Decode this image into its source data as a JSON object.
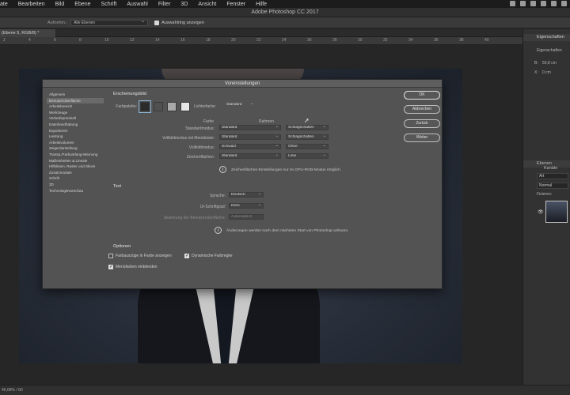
{
  "menubar": {
    "items": [
      "ate",
      "Bearbeiten",
      "Bild",
      "Ebene",
      "Schrift",
      "Auswahl",
      "Filter",
      "3D",
      "Ansicht",
      "Fenster",
      "Hilfe"
    ]
  },
  "app": {
    "title": "Adobe Photoshop CC 2017"
  },
  "options_bar": {
    "sample_label": "Aufnehm.:",
    "sample_value": "Alle Ebenen",
    "show_ring_label": "Auswahlring anzeigen"
  },
  "document": {
    "tab_label": "(Ebene 5, RGB/8) *",
    "ruler_ticks": [
      "2",
      "4",
      "6",
      "8",
      "10",
      "12",
      "14",
      "16",
      "18",
      "20",
      "22",
      "24",
      "26",
      "28",
      "30",
      "32",
      "34",
      "36",
      "38",
      "40"
    ]
  },
  "status_bar": {
    "zoom_text": "46,68% / 60"
  },
  "right_panel": {
    "properties_header": "Eigenschaften",
    "properties_sub": "Eigenschaften",
    "width_label": "B:",
    "width_value": "50,8 cm",
    "x_label": "X:",
    "x_value": "0 cm",
    "layers_header": "Ebenen",
    "channels_header": "Kanäle",
    "layer_kind": "Art",
    "blend_mode": "Normal",
    "lock_label": "Fixieren:"
  },
  "dialog": {
    "title": "Voreinstellungen",
    "nav_items": [
      "Allgemein",
      "Benutzeroberfläche",
      "Arbeitsbereich",
      "Werkzeuge",
      "Verlaufsprotokoll",
      "Dateihandhabung",
      "Exportieren",
      "Leistung",
      "Arbeitsvolumes",
      "Zeigerdarstellung",
      "Transp./Farbumfang-Warnung",
      "Maßeinheiten & Lineale",
      "Hilfslinien, Raster und Slices",
      "Zusatzmodule",
      "Schrift",
      "3D",
      "Technologievorschau"
    ],
    "active_nav_index": 1,
    "appearance": {
      "section_title": "Erscheinungsbild",
      "color_theme_label": "Farbpalette:",
      "highlight_label": "Lichterfarbe:",
      "highlight_value": "Standard",
      "col_color": "Farbe",
      "col_border": "Rahmen",
      "rows": [
        {
          "label": "Standardmodus:",
          "color": "Standard",
          "border": "Schlagschatten"
        },
        {
          "label": "Vollbildmodus mit Menüleiste:",
          "color": "Standard",
          "border": "Schlagschatten"
        },
        {
          "label": "Vollbildmodus:",
          "color": "Schwarz",
          "border": "Ohne"
        },
        {
          "label": "Zeichenflächen:",
          "color": "Standard",
          "border": "Linie"
        }
      ],
      "info": "Zeichenflächen-Einstellungen nur im GPU-RGB-Modus möglich."
    },
    "text": {
      "section_title": "Text",
      "language_label": "Sprache:",
      "language_value": "Deutsch",
      "font_size_label": "UI-Schriftgrad:",
      "font_size_value": "Klein",
      "scaling_label": "Skalierung der Benutzeroberfläche:",
      "scaling_value": "Automatisch",
      "info": "Änderungen werden nach dem nächsten Start von Photoshop wirksam."
    },
    "options": {
      "section_title": "Optionen",
      "checkbox1": "Farbauszüge in Farbe anzeigen",
      "checkbox2": "Dynamische Farbregler",
      "checkbox3": "Menüfarben einblenden"
    },
    "buttons": {
      "ok": "OK",
      "cancel": "Abbrechen",
      "back": "Zurück",
      "next": "Weiter"
    }
  },
  "colors": {
    "swatch1": "#2b2b2b",
    "swatch2": "#505050",
    "swatch3": "#a9a9a9",
    "swatch4": "#e6e6e6"
  }
}
